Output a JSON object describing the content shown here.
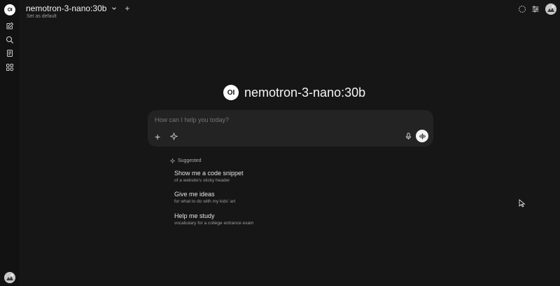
{
  "sidebar": {
    "logo_text": "OI",
    "icons": [
      "new-chat-icon",
      "search-icon",
      "notes-icon",
      "workspace-icon"
    ]
  },
  "header": {
    "model_name": "nemotron-3-nano:30b",
    "set_default": "Set as default",
    "right_icons": [
      "temporary-chat-icon",
      "controls-icon"
    ]
  },
  "hero": {
    "logo_text": "OI",
    "title": "nemotron-3-nano:30b"
  },
  "chat": {
    "placeholder": "How can I help you today?",
    "plus": "+"
  },
  "suggestions": {
    "header": "Suggested",
    "items": [
      {
        "title": "Show me a code snippet",
        "subtitle": "of a website's sticky header"
      },
      {
        "title": "Give me ideas",
        "subtitle": "for what to do with my kids' art"
      },
      {
        "title": "Help me study",
        "subtitle": "vocabulary for a college entrance exam"
      }
    ]
  },
  "colors": {
    "background": "#161616",
    "sidebar": "#121212",
    "input": "#232323"
  }
}
